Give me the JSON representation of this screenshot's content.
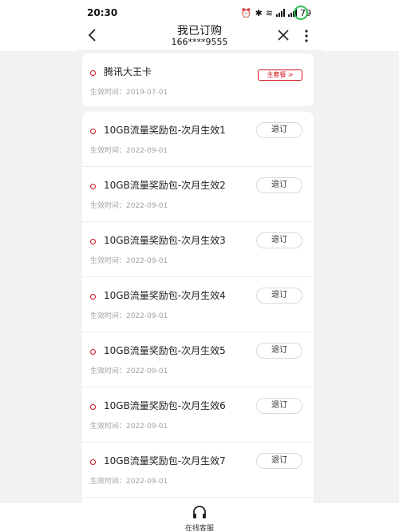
{
  "status_bar": {
    "time": "20:30",
    "battery": "79"
  },
  "header": {
    "title": "我已订购",
    "phone": "166****9555"
  },
  "plan": {
    "name": "腾讯大王卡",
    "date_label": "生效时间：2019-07-01",
    "badge": "主套餐 >"
  },
  "addons": [
    {
      "name": "10GB流量奖励包-次月生效1",
      "date_label": "生效时间：2022-09-01",
      "action": "退订"
    },
    {
      "name": "10GB流量奖励包-次月生效2",
      "date_label": "生效时间：2022-09-01",
      "action": "退订"
    },
    {
      "name": "10GB流量奖励包-次月生效3",
      "date_label": "生效时间：2022-09-01",
      "action": "退订"
    },
    {
      "name": "10GB流量奖励包-次月生效4",
      "date_label": "生效时间：2022-09-01",
      "action": "退订"
    },
    {
      "name": "10GB流量奖励包-次月生效5",
      "date_label": "生效时间：2022-09-01",
      "action": "退订"
    },
    {
      "name": "10GB流量奖励包-次月生效6",
      "date_label": "生效时间：2022-09-01",
      "action": "退订"
    },
    {
      "name": "10GB流量奖励包-次月生效7",
      "date_label": "生效时间：2022-09-01",
      "action": "退订"
    }
  ],
  "bottom": {
    "service_label": "在线客服"
  },
  "colors": {
    "accent": "#d0101b",
    "battery": "#2fbf4f"
  }
}
